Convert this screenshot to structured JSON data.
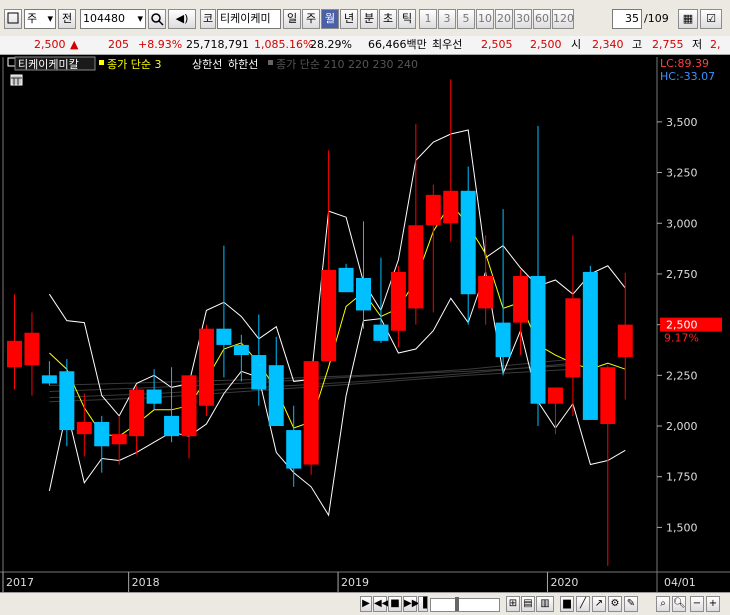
{
  "toolbar": {
    "market": "주",
    "prev_label": "전",
    "code": "104480",
    "name_prefix": "코",
    "name": "티케이케미",
    "periods": [
      "일",
      "주",
      "월",
      "년"
    ],
    "active_period": "월",
    "min_label": "분",
    "sec_label": "초",
    "tick_label": "틱",
    "intervals": [
      "1",
      "3",
      "5",
      "10",
      "20",
      "30",
      "60",
      "120"
    ],
    "count": "35",
    "count_total": "/109"
  },
  "quote": {
    "price": "2,500",
    "arrow": "▲",
    "change": "205",
    "change_pct": "+8.93%",
    "volume": "25,718,791",
    "volume_pct": "1,085.16%",
    "turnover": "28.29%",
    "amount": "66,466백만",
    "best_ask_label": "최우선",
    "best_ask": "2,505",
    "best_bid": "2,500",
    "open_label": "시",
    "open": "2,340",
    "high_label": "고",
    "high": "2,755",
    "low_label": "저",
    "low": "2,"
  },
  "legend": {
    "stock_name": "티케이케미칼",
    "ma_label": "종가 단순 3",
    "upper_label": "상한선",
    "lower_label": "하한선",
    "ma_group_label": "종가 단순 210 220 230 240"
  },
  "overlay": {
    "lc": "LC:89.39",
    "hc": "HC:-33.07",
    "current_price": "2,500",
    "current_pct": "9.17%"
  },
  "colors": {
    "up": "#ff0000",
    "down": "#00c0ff",
    "ma": "#ffff00",
    "band": "#ffffff",
    "bg": "#000000"
  },
  "chart_data": {
    "type": "candlestick",
    "period": "monthly",
    "ylim": [
      1280,
      3820
    ],
    "y_ticks": [
      "3,500",
      "3,250",
      "3,000",
      "2,750",
      "2,500",
      "2,250",
      "2,000",
      "1,750",
      "1,500"
    ],
    "x_labels": [
      {
        "label": "2017",
        "index": 0
      },
      {
        "label": "2018",
        "index": 7
      },
      {
        "label": "2019",
        "index": 19
      },
      {
        "label": "2020",
        "index": 31
      }
    ],
    "x_end_label": "04/01",
    "candles": [
      {
        "o": 2290,
        "h": 2650,
        "l": 2180,
        "c": 2420
      },
      {
        "o": 2300,
        "h": 2560,
        "l": 2150,
        "c": 2460
      },
      {
        "o": 2250,
        "h": 2320,
        "l": 2200,
        "c": 2210
      },
      {
        "o": 2270,
        "h": 2330,
        "l": 1900,
        "c": 1980
      },
      {
        "o": 1960,
        "h": 2160,
        "l": 1850,
        "c": 2020
      },
      {
        "o": 2020,
        "h": 2050,
        "l": 1770,
        "c": 1900
      },
      {
        "o": 1910,
        "h": 2050,
        "l": 1810,
        "c": 1960
      },
      {
        "o": 1950,
        "h": 2200,
        "l": 1860,
        "c": 2180
      },
      {
        "o": 2180,
        "h": 2280,
        "l": 2080,
        "c": 2110
      },
      {
        "o": 2050,
        "h": 2290,
        "l": 1920,
        "c": 1950
      },
      {
        "o": 1950,
        "h": 2250,
        "l": 1840,
        "c": 2250
      },
      {
        "o": 2100,
        "h": 2500,
        "l": 2050,
        "c": 2480
      },
      {
        "o": 2480,
        "h": 2890,
        "l": 2240,
        "c": 2400
      },
      {
        "o": 2400,
        "h": 2450,
        "l": 2220,
        "c": 2350
      },
      {
        "o": 2350,
        "h": 2550,
        "l": 2100,
        "c": 2180
      },
      {
        "o": 2300,
        "h": 2440,
        "l": 2050,
        "c": 2000
      },
      {
        "o": 1980,
        "h": 2100,
        "l": 1700,
        "c": 1790
      },
      {
        "o": 1810,
        "h": 2230,
        "l": 1760,
        "c": 2320
      },
      {
        "o": 2320,
        "h": 3360,
        "l": 2330,
        "c": 2770
      },
      {
        "o": 2780,
        "h": 2800,
        "l": 2710,
        "c": 2660
      },
      {
        "o": 2730,
        "h": 3010,
        "l": 2480,
        "c": 2570
      },
      {
        "o": 2500,
        "h": 2830,
        "l": 2410,
        "c": 2420
      },
      {
        "o": 2470,
        "h": 2790,
        "l": 2390,
        "c": 2760
      },
      {
        "o": 2580,
        "h": 3490,
        "l": 2500,
        "c": 2990
      },
      {
        "o": 2990,
        "h": 3190,
        "l": 2560,
        "c": 3140
      },
      {
        "o": 3000,
        "h": 3710,
        "l": 2910,
        "c": 3160
      },
      {
        "o": 3160,
        "h": 3280,
        "l": 2500,
        "c": 2650
      },
      {
        "o": 2580,
        "h": 2940,
        "l": 2500,
        "c": 2740
      },
      {
        "o": 2510,
        "h": 3070,
        "l": 2250,
        "c": 2340
      },
      {
        "o": 2510,
        "h": 2770,
        "l": 2350,
        "c": 2740
      },
      {
        "o": 2740,
        "h": 3480,
        "l": 2000,
        "c": 2110
      },
      {
        "o": 2110,
        "h": 2190,
        "l": 1960,
        "c": 2190
      },
      {
        "o": 2240,
        "h": 2940,
        "l": 2050,
        "c": 2630
      },
      {
        "o": 2760,
        "h": 2790,
        "l": 2030,
        "c": 2030
      },
      {
        "o": 2010,
        "h": 2300,
        "l": 1310,
        "c": 2290
      },
      {
        "o": 2340,
        "h": 2755,
        "l": 2130,
        "c": 2500
      }
    ],
    "ma3": [
      null,
      null,
      2360,
      2280,
      2090,
      1960,
      1950,
      2010,
      2080,
      2080,
      2100,
      2230,
      2380,
      2410,
      2310,
      2180,
      1990,
      2020,
      2290,
      2590,
      2660,
      2540,
      2580,
      2720,
      2960,
      3100,
      2990,
      2850,
      2580,
      2610,
      2400,
      2350,
      2310,
      2280,
      2310,
      2280
    ],
    "upper": [
      null,
      null,
      2650,
      2520,
      2510,
      2150,
      2050,
      2210,
      2250,
      2190,
      2210,
      2570,
      2610,
      2540,
      2430,
      2490,
      2220,
      2230,
      3060,
      3030,
      2710,
      2570,
      2820,
      3310,
      3400,
      3440,
      3460,
      2830,
      2890,
      2780,
      2690,
      2720,
      2650,
      2750,
      2790,
      2680
    ],
    "lower": [
      null,
      null,
      1680,
      2080,
      1720,
      1840,
      1830,
      1870,
      1920,
      1970,
      1950,
      2010,
      2160,
      2270,
      2240,
      1870,
      1770,
      1700,
      1560,
      2150,
      2520,
      2530,
      2360,
      2380,
      2470,
      2630,
      2510,
      2760,
      2260,
      2470,
      2120,
      1990,
      2110,
      1810,
      1830,
      1880
    ]
  }
}
